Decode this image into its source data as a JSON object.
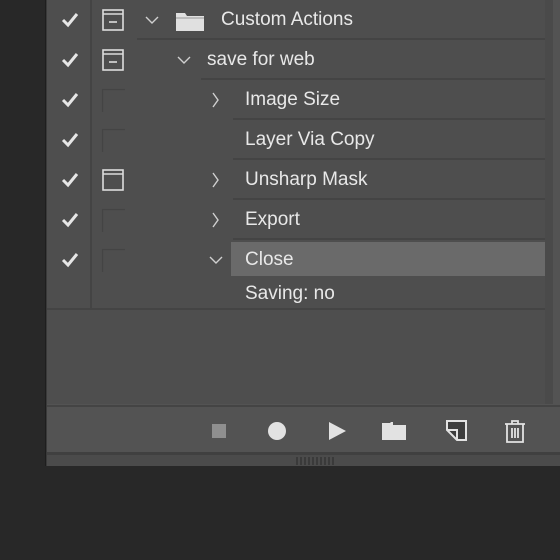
{
  "actions_panel": {
    "rows": [
      {
        "label": "Custom Actions",
        "type": "set",
        "enabled": true,
        "dialog": "toggle-on",
        "expanded": true,
        "selected": false
      },
      {
        "label": "save for web",
        "type": "action",
        "enabled": true,
        "dialog": "toggle-on",
        "expanded": true,
        "selected": false
      },
      {
        "label": "Image Size",
        "type": "step",
        "enabled": true,
        "dialog": "empty",
        "expanded": false,
        "selected": false
      },
      {
        "label": "Layer Via Copy",
        "type": "step",
        "enabled": true,
        "dialog": "empty",
        "expanded": null,
        "selected": false
      },
      {
        "label": "Unsharp Mask",
        "type": "step",
        "enabled": true,
        "dialog": "dialog",
        "expanded": false,
        "selected": false
      },
      {
        "label": "Export",
        "type": "step",
        "enabled": true,
        "dialog": "empty",
        "expanded": false,
        "selected": false
      },
      {
        "label": "Close",
        "type": "step",
        "enabled": true,
        "dialog": "empty",
        "expanded": true,
        "selected": true
      },
      {
        "label": "Saving: no",
        "type": "detail"
      }
    ],
    "toolbar": {
      "stop": "stop-icon",
      "record": "record-icon",
      "play": "play-icon",
      "new_set": "folder-icon",
      "new_action": "new-item-icon",
      "delete": "trash-icon"
    }
  }
}
